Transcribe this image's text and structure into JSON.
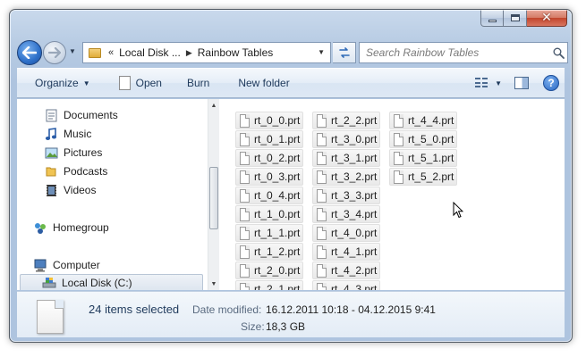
{
  "window": {
    "caption_buttons": {
      "minimize": "minimize",
      "maximize": "maximize",
      "close": "close"
    }
  },
  "navbar": {
    "back_icon": "back-arrow-icon",
    "forward_icon": "forward-arrow-icon",
    "address": {
      "overflow": "«",
      "segments": [
        "Local Disk ...",
        "Rainbow Tables"
      ]
    },
    "search_placeholder": "Search Rainbow Tables"
  },
  "toolbar": {
    "organize_label": "Organize",
    "open_label": "Open",
    "burn_label": "Burn",
    "new_folder_label": "New folder"
  },
  "nav_pane": {
    "libraries": [
      {
        "label": "Documents",
        "icon": "documents-icon"
      },
      {
        "label": "Music",
        "icon": "music-icon"
      },
      {
        "label": "Pictures",
        "icon": "pictures-icon"
      },
      {
        "label": "Podcasts",
        "icon": "podcasts-icon"
      },
      {
        "label": "Videos",
        "icon": "videos-icon"
      }
    ],
    "homegroup_label": "Homegroup",
    "computer_label": "Computer",
    "selected_drive_label": "Local Disk (C:)"
  },
  "files": {
    "col1": [
      "rt_0_0.prt",
      "rt_0_1.prt",
      "rt_0_2.prt",
      "rt_0_3.prt",
      "rt_0_4.prt",
      "rt_1_0.prt",
      "rt_1_1.prt",
      "rt_1_2.prt",
      "rt_2_0.prt",
      "rt_2_1.prt"
    ],
    "col2": [
      "rt_2_2.prt",
      "rt_3_0.prt",
      "rt_3_1.prt",
      "rt_3_2.prt",
      "rt_3_3.prt",
      "rt_3_4.prt",
      "rt_4_0.prt",
      "rt_4_1.prt",
      "rt_4_2.prt",
      "rt_4_3.prt"
    ],
    "col3": [
      "rt_4_4.prt",
      "rt_5_0.prt",
      "rt_5_1.prt",
      "rt_5_2.prt"
    ]
  },
  "details": {
    "selection_count": "24 items selected",
    "date_modified_label": "Date modified:",
    "date_modified_value": "16.12.2011 10:18 - 04.12.2015 9:41",
    "size_label": "Size:",
    "size_value": "18,3 GB"
  },
  "colors": {
    "frame": "#aec4df",
    "accent": "#1e395b",
    "close": "#c2452c"
  }
}
